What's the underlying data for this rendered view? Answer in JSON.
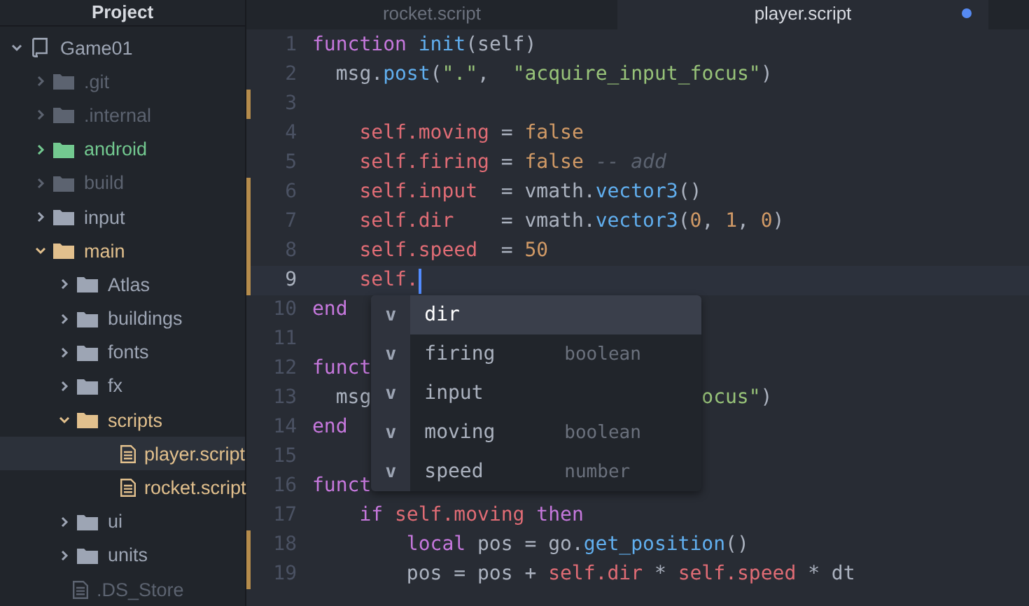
{
  "sidebar": {
    "title": "Project",
    "tree": {
      "name": "Game01",
      "kind": "repo",
      "expanded": true,
      "selected": false,
      "color": "#9da5b4",
      "children": [
        {
          "name": ".git",
          "kind": "folder",
          "expanded": false,
          "selected": false,
          "color": "#5c6370"
        },
        {
          "name": ".internal",
          "kind": "folder",
          "expanded": false,
          "selected": false,
          "color": "#5c6370"
        },
        {
          "name": "android",
          "kind": "folder",
          "expanded": false,
          "selected": false,
          "color": "#73c990"
        },
        {
          "name": "build",
          "kind": "folder",
          "expanded": false,
          "selected": false,
          "color": "#5c6370"
        },
        {
          "name": "input",
          "kind": "folder",
          "expanded": false,
          "selected": false,
          "color": "#9da5b4"
        },
        {
          "name": "main",
          "kind": "folder",
          "expanded": true,
          "selected": false,
          "color": "#e2c08d",
          "children": [
            {
              "name": "Atlas",
              "kind": "folder",
              "expanded": false,
              "selected": false,
              "color": "#9da5b4"
            },
            {
              "name": "buildings",
              "kind": "folder",
              "expanded": false,
              "selected": false,
              "color": "#9da5b4"
            },
            {
              "name": "fonts",
              "kind": "folder",
              "expanded": false,
              "selected": false,
              "color": "#9da5b4"
            },
            {
              "name": "fx",
              "kind": "folder",
              "expanded": false,
              "selected": false,
              "color": "#9da5b4"
            },
            {
              "name": "scripts",
              "kind": "folder",
              "expanded": true,
              "selected": false,
              "color": "#e2c08d",
              "children": [
                {
                  "name": "player.script",
                  "kind": "file",
                  "selected": true,
                  "color": "#e2c08d"
                },
                {
                  "name": "rocket.script",
                  "kind": "file",
                  "selected": false,
                  "color": "#e2c08d"
                }
              ]
            },
            {
              "name": "ui",
              "kind": "folder",
              "expanded": false,
              "selected": false,
              "color": "#9da5b4"
            },
            {
              "name": "units",
              "kind": "folder",
              "expanded": false,
              "selected": false,
              "color": "#9da5b4"
            }
          ]
        },
        {
          "name": ".DS_Store",
          "kind": "file",
          "selected": false,
          "color": "#5c6370"
        }
      ]
    }
  },
  "tabs": [
    {
      "label": "rocket.script",
      "selected": false,
      "modified": false
    },
    {
      "label": "player.script",
      "selected": true,
      "modified": true
    }
  ],
  "editor": {
    "lines": [
      {
        "number": "1",
        "modified": false,
        "current": false,
        "tokens": [
          {
            "kind": "kw",
            "text": "function"
          },
          {
            "kind": "fn",
            "text": " init"
          },
          {
            "kind": "plain",
            "text": "(self)"
          }
        ]
      },
      {
        "number": "2",
        "modified": false,
        "current": false,
        "tokens": [
          {
            "kind": "plain",
            "text": "  msg."
          },
          {
            "kind": "fn",
            "text": "post"
          },
          {
            "kind": "plain",
            "text": "("
          },
          {
            "kind": "str",
            "text": "\".\""
          },
          {
            "kind": "plain",
            "text": ",  "
          },
          {
            "kind": "str",
            "text": "\"acquire_input_focus\""
          },
          {
            "kind": "plain",
            "text": ")"
          }
        ]
      },
      {
        "number": "3",
        "modified": true,
        "current": false
      },
      {
        "number": "4",
        "modified": false,
        "current": false,
        "tokens": [
          {
            "kind": "self",
            "text": "    self."
          },
          {
            "kind": "prop",
            "text": "moving"
          },
          {
            "kind": "plain",
            "text": " = "
          },
          {
            "kind": "num",
            "text": "false"
          }
        ]
      },
      {
        "number": "5",
        "modified": false,
        "current": false,
        "tokens": [
          {
            "kind": "self",
            "text": "    self."
          },
          {
            "kind": "prop",
            "text": "firing"
          },
          {
            "kind": "plain",
            "text": " = "
          },
          {
            "kind": "num",
            "text": "false"
          },
          {
            "kind": "comment",
            "text": " -- add"
          }
        ]
      },
      {
        "number": "6",
        "modified": true,
        "current": false,
        "tokens": [
          {
            "kind": "self",
            "text": "    self."
          },
          {
            "kind": "prop",
            "text": "input"
          },
          {
            "kind": "plain",
            "text": "  = vmath."
          },
          {
            "kind": "fn",
            "text": "vector3"
          },
          {
            "kind": "plain",
            "text": "()"
          }
        ]
      },
      {
        "number": "7",
        "modified": true,
        "current": false,
        "tokens": [
          {
            "kind": "self",
            "text": "    self."
          },
          {
            "kind": "prop",
            "text": "dir"
          },
          {
            "kind": "plain",
            "text": "    = vmath."
          },
          {
            "kind": "fn",
            "text": "vector3"
          },
          {
            "kind": "plain",
            "text": "("
          },
          {
            "kind": "num",
            "text": "0"
          },
          {
            "kind": "plain",
            "text": ", "
          },
          {
            "kind": "num",
            "text": "1"
          },
          {
            "kind": "plain",
            "text": ", "
          },
          {
            "kind": "num",
            "text": "0"
          },
          {
            "kind": "plain",
            "text": ")"
          }
        ]
      },
      {
        "number": "8",
        "modified": true,
        "current": false,
        "tokens": [
          {
            "kind": "self",
            "text": "    self."
          },
          {
            "kind": "prop",
            "text": "speed"
          },
          {
            "kind": "plain",
            "text": "  = "
          },
          {
            "kind": "num",
            "text": "50"
          }
        ]
      },
      {
        "number": "9",
        "modified": true,
        "current": true,
        "tokens": [
          {
            "kind": "self",
            "text": "    self."
          }
        ]
      },
      {
        "number": "10",
        "modified": false,
        "current": false,
        "tokens": [
          {
            "kind": "kw",
            "text": "end"
          }
        ]
      },
      {
        "number": "11",
        "modified": false,
        "current": false
      },
      {
        "number": "12",
        "modified": false,
        "current": false,
        "tokens": [
          {
            "kind": "kw",
            "text": "funct"
          }
        ]
      },
      {
        "number": "13",
        "modified": false,
        "current": false,
        "tokens": [
          {
            "kind": "plain",
            "text": "  msg"
          }
        ],
        "tail": [
          {
            "kind": "str",
            "text": "ocus\""
          },
          {
            "kind": "plain",
            "text": ")"
          }
        ]
      },
      {
        "number": "14",
        "modified": false,
        "current": false,
        "tokens": [
          {
            "kind": "kw",
            "text": "end"
          }
        ]
      },
      {
        "number": "15",
        "modified": false,
        "current": false
      },
      {
        "number": "16",
        "modified": false,
        "current": false,
        "tokens": [
          {
            "kind": "kw",
            "text": "funct"
          }
        ]
      },
      {
        "number": "17",
        "modified": false,
        "current": false,
        "tokens": [
          {
            "kind": "kw",
            "text": "    if"
          },
          {
            "kind": "self",
            "text": " self."
          },
          {
            "kind": "prop",
            "text": "moving"
          },
          {
            "kind": "kw",
            "text": " then"
          }
        ]
      },
      {
        "number": "18",
        "modified": true,
        "current": false,
        "tokens": [
          {
            "kind": "kw",
            "text": "        local"
          },
          {
            "kind": "plain",
            "text": " pos = go."
          },
          {
            "kind": "fn",
            "text": "get_position"
          },
          {
            "kind": "plain",
            "text": "()"
          }
        ]
      },
      {
        "number": "19",
        "modified": true,
        "current": false,
        "tokens": [
          {
            "kind": "plain",
            "text": "        pos = pos + "
          },
          {
            "kind": "self",
            "text": "self."
          },
          {
            "kind": "prop",
            "text": "dir"
          },
          {
            "kind": "plain",
            "text": " * "
          },
          {
            "kind": "self",
            "text": "self."
          },
          {
            "kind": "prop",
            "text": "speed"
          },
          {
            "kind": "plain",
            "text": " * dt"
          }
        ]
      }
    ],
    "autocomplete": [
      {
        "icon": "v",
        "label": "dir",
        "selected": true
      },
      {
        "icon": "v",
        "label": "firing",
        "type": "boolean",
        "selected": false
      },
      {
        "icon": "v",
        "label": "input",
        "selected": false
      },
      {
        "icon": "v",
        "label": "moving",
        "type": "boolean",
        "selected": false
      },
      {
        "icon": "v",
        "label": "speed",
        "type": "number",
        "selected": false
      }
    ]
  }
}
